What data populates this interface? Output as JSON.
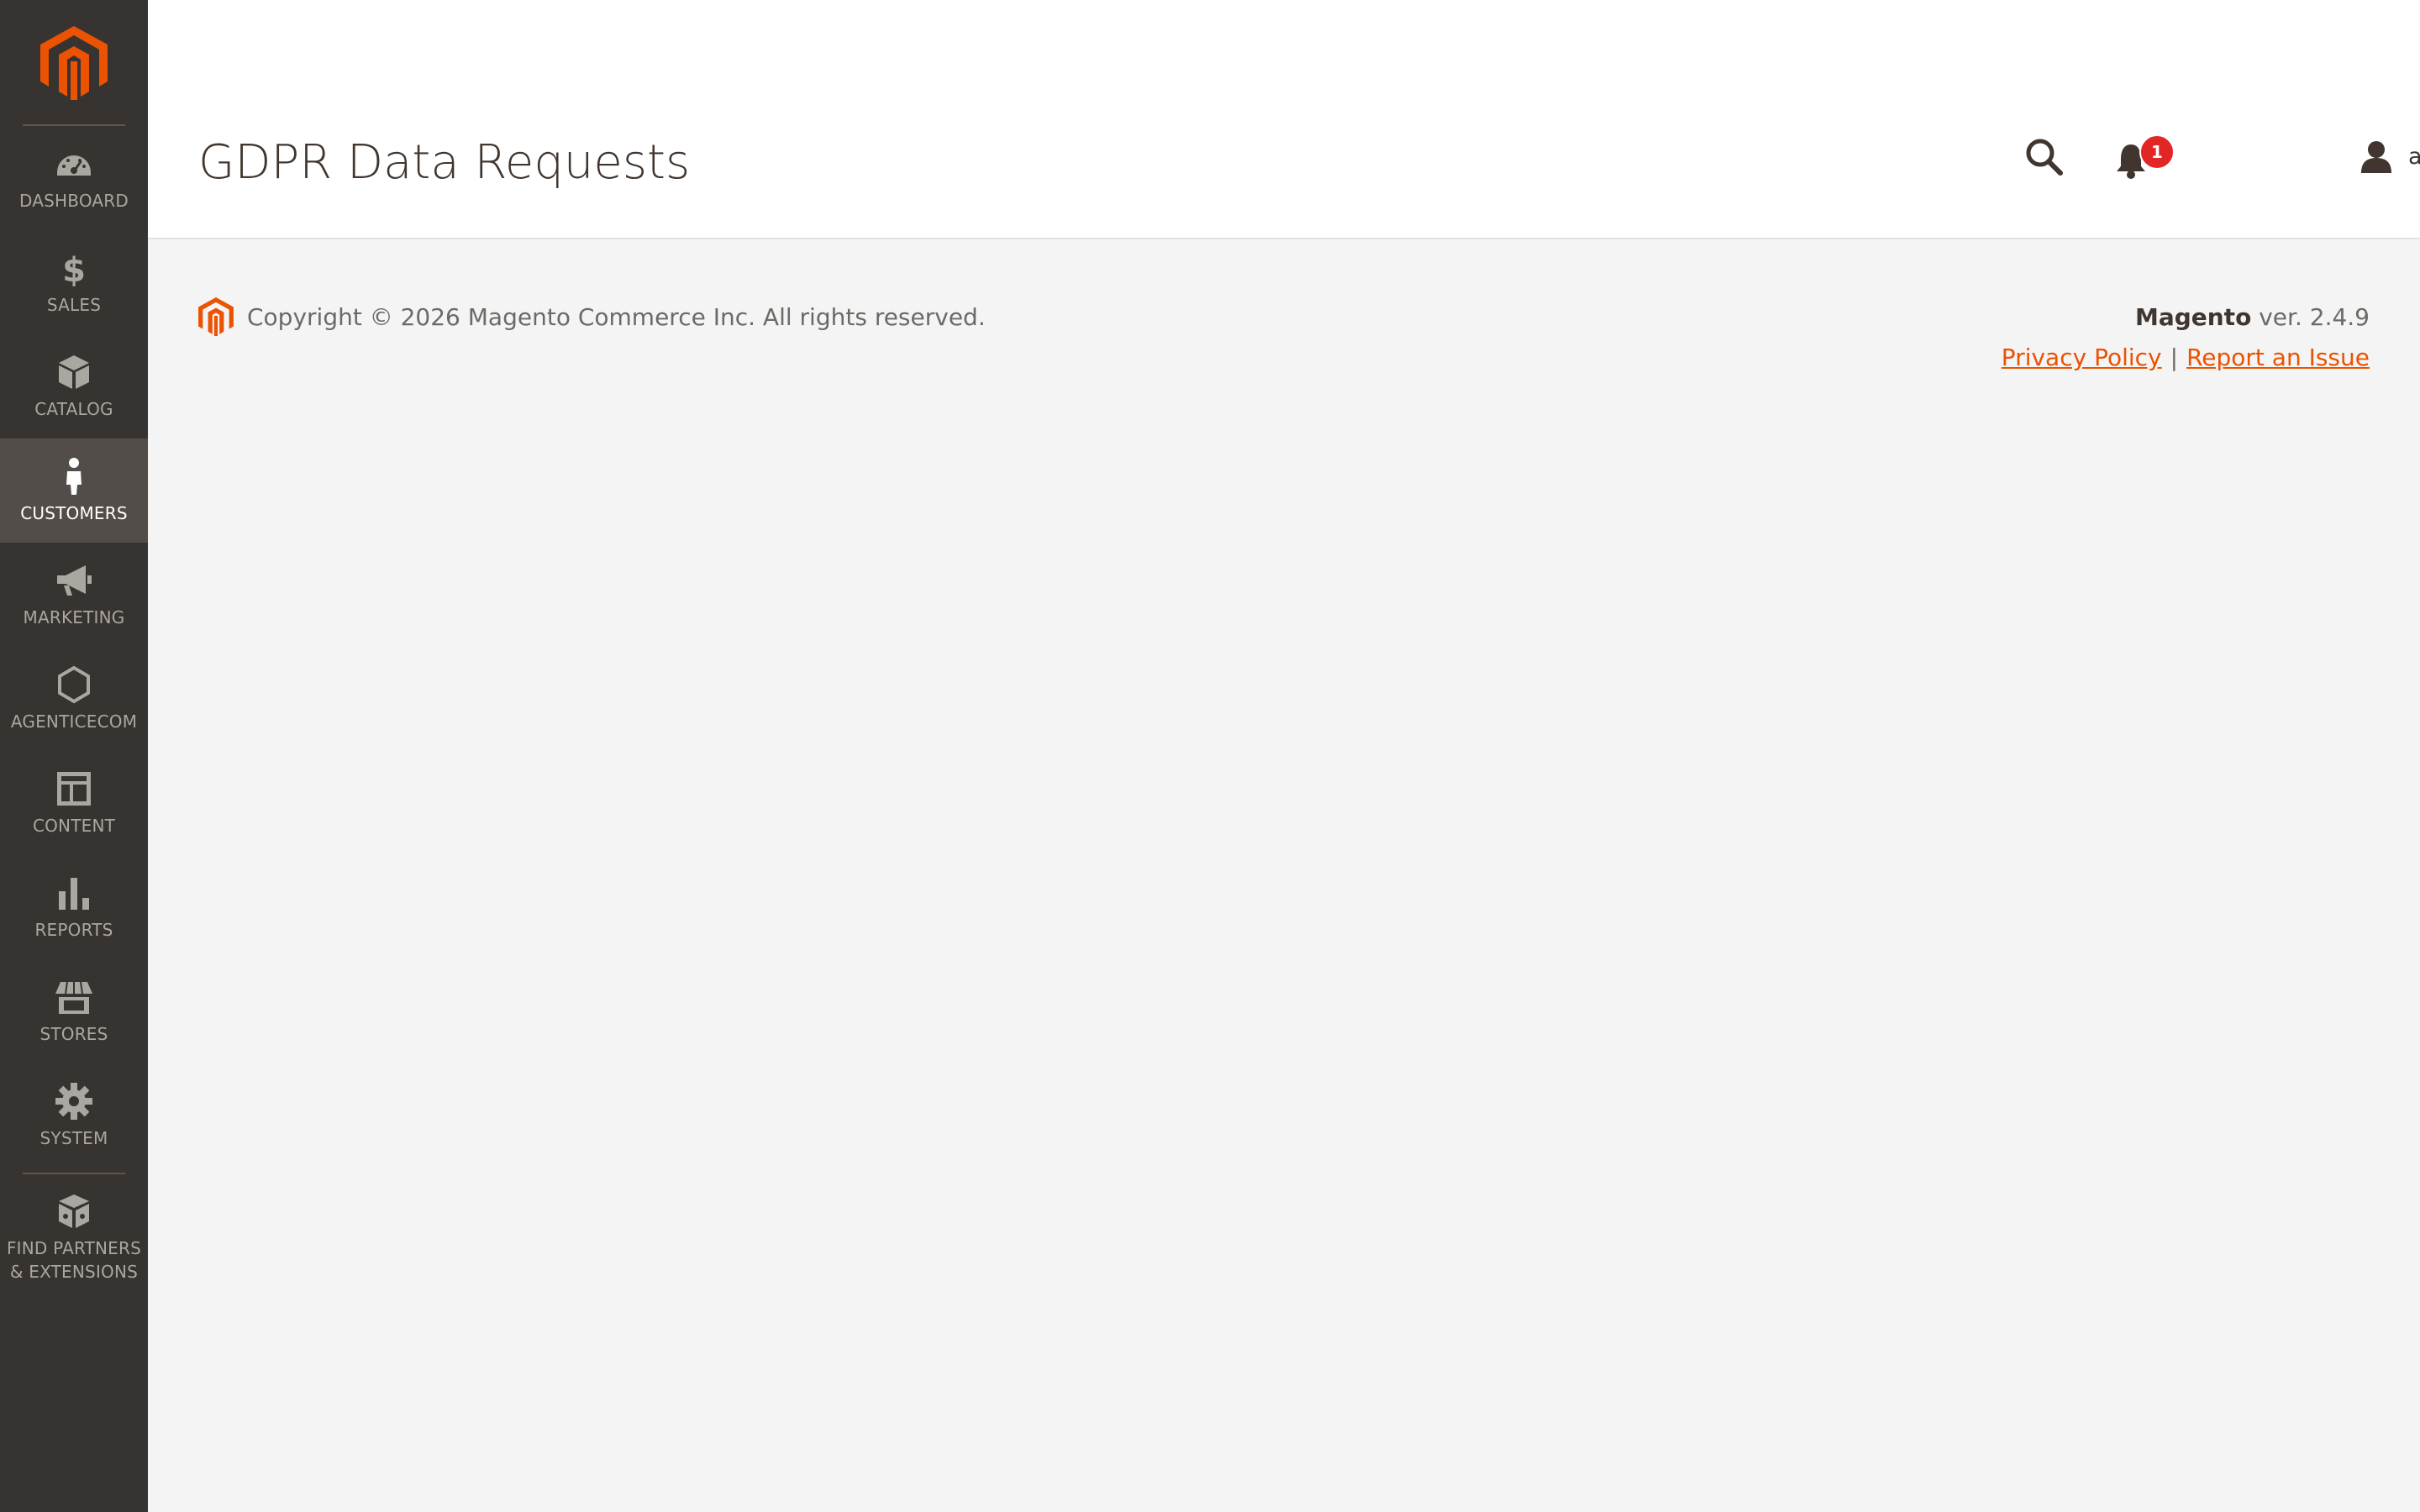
{
  "page": {
    "title": "GDPR Data Requests"
  },
  "header": {
    "notifications_count": "1",
    "user_name": "admin"
  },
  "sidebar": {
    "items": [
      {
        "label": "DASHBOARD",
        "icon": "dashboard-icon"
      },
      {
        "label": "SALES",
        "icon": "dollar-icon"
      },
      {
        "label": "CATALOG",
        "icon": "box-icon"
      },
      {
        "label": "CUSTOMERS",
        "icon": "person-icon",
        "active": true
      },
      {
        "label": "MARKETING",
        "icon": "megaphone-icon"
      },
      {
        "label": "AGENTICECOM",
        "icon": "hexagon-icon"
      },
      {
        "label": "CONTENT",
        "icon": "layout-icon"
      },
      {
        "label": "REPORTS",
        "icon": "bar-chart-icon"
      },
      {
        "label": "STORES",
        "icon": "storefront-icon"
      },
      {
        "label": "SYSTEM",
        "icon": "gear-icon"
      }
    ],
    "partners_label_line1": "FIND PARTNERS",
    "partners_label_line2": "& EXTENSIONS"
  },
  "footer": {
    "copyright": "Copyright © 2026 Magento Commerce Inc. All rights reserved.",
    "brand": "Magento",
    "version": " ver. 2.4.9",
    "privacy_link": "Privacy Policy",
    "separator": "|",
    "report_link": "Report an Issue"
  },
  "colors": {
    "sidebar_bg": "#373330",
    "sidebar_active_bg": "#524d49",
    "brand_orange": "#eb5202",
    "badge_red": "#e22626",
    "page_bg": "#f4f4f4"
  }
}
